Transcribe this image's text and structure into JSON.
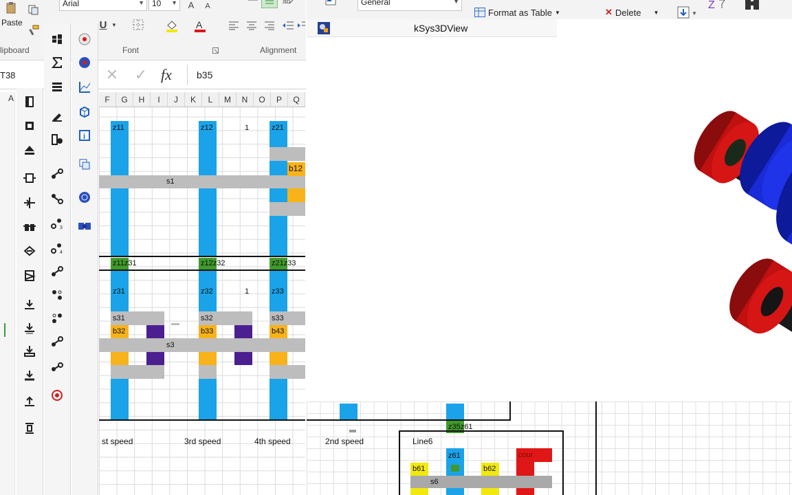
{
  "ribbon": {
    "paste_label": "Paste",
    "clipboard_group": "lipboard",
    "font_name": "Arial",
    "font_size": "10",
    "underline_label": "U",
    "font_group": "Font",
    "alignment_group": "Alignment",
    "number_format": "General",
    "format_as_table": "Format as Table",
    "delete_label": "Delete"
  },
  "formula_bar": {
    "name_box": "T38",
    "fx_label": "fx",
    "content": "b35"
  },
  "columns": [
    "F",
    "G",
    "H",
    "I",
    "J",
    "K",
    "L",
    "M",
    "N",
    "O",
    "P",
    "Q"
  ],
  "cells": {
    "z11": "z11",
    "z12": "z12",
    "one_a": "1",
    "z21": "z21",
    "b12": "b12",
    "s1": "s1",
    "z11z31": "z11z31",
    "z12z32": "z12z32",
    "z21z33": "z21z33",
    "z31": "z31",
    "z32": "z32",
    "one_b": "1",
    "z33": "z33",
    "s31": "s31",
    "s32": "s32",
    "s33": "s33",
    "b32": "b32",
    "b33": "b33",
    "b43": "b43",
    "s3": "s3"
  },
  "lower_labels": {
    "speed1": "st speed",
    "speed3": "3rd speed",
    "speed4": "4th speed",
    "speed2": "2nd speed",
    "line6": "Line6",
    "z35z61": "z35z61",
    "z61": "z61",
    "b61": "b61",
    "b62": "b62",
    "s6": "s6",
    "cour": "cour"
  },
  "view3d": {
    "title": "kSys3DView"
  },
  "colors": {
    "shaft_blue": "#1aa3e8",
    "gray_bar": "#bdbdbd",
    "orange": "#f8b31a",
    "green": "#3f9a2b",
    "purple": "#4b1f8f",
    "yellow": "#f2e80c",
    "red": "#e01717",
    "gear_blue": "#1f2fe0",
    "gear_red": "#c01010",
    "gear_green": "#0f5c14"
  }
}
